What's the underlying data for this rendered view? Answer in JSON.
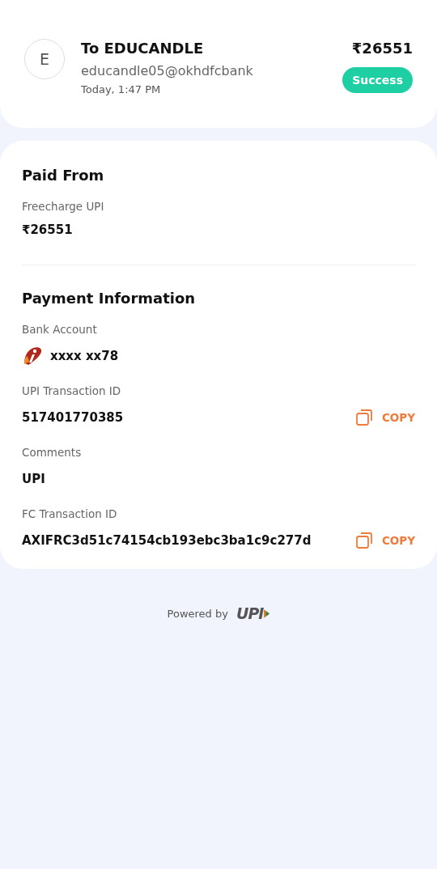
{
  "payee": {
    "initial": "E",
    "name": "To EDUCANDLE",
    "upi_id": "educandle05@okhdfcbank",
    "time": "Today, 1:47 PM",
    "amount": "₹26551",
    "status": "Success"
  },
  "paid_from": {
    "title": "Paid From",
    "label": "Freecharge UPI",
    "value": "₹26551"
  },
  "payment_info": {
    "title": "Payment Information",
    "fields": [
      {
        "kind": "bank",
        "label": "Bank Account",
        "value": "xxxx xx78"
      },
      {
        "kind": "copy",
        "label": "UPI Transaction ID",
        "value": "517401770385",
        "action": "COPY"
      },
      {
        "kind": "plain",
        "label": "Comments",
        "value": "UPI"
      },
      {
        "kind": "copy",
        "label": "FC Transaction ID",
        "value": "AXIFRC3d51c74154cb193ebc3ba1c9c277d",
        "action": "COPY"
      }
    ]
  },
  "footer": {
    "text": "Powered by",
    "logo": "UPI"
  }
}
